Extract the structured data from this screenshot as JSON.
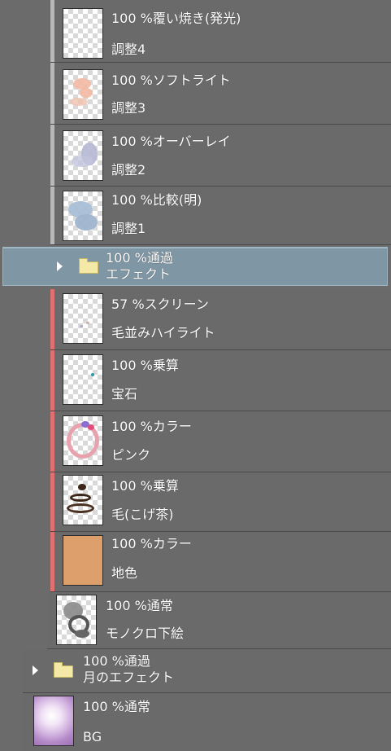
{
  "colors": {
    "panel_bg": "#6a6a6a",
    "selected_bg": "#7f96a4",
    "clip_bar_gray": "#b8b8b8",
    "clip_bar_red": "#e07070",
    "folder": "#f5e9a8",
    "base_color_fill": "#dd9f6c"
  },
  "layers": [
    {
      "opacity": "100 %",
      "blend": "覆い焼き(発光)",
      "name": "調整4",
      "bar": "gray",
      "thumbnail": "transparent-checker"
    },
    {
      "opacity": "100 %",
      "blend": "ソフトライト",
      "name": "調整3",
      "bar": "gray",
      "thumbnail": "peach-strokes"
    },
    {
      "opacity": "100 %",
      "blend": "オーバーレイ",
      "name": "調整2",
      "bar": "gray",
      "thumbnail": "lavender-strokes"
    },
    {
      "opacity": "100 %",
      "blend": "比較(明)",
      "name": "調整1",
      "bar": "gray",
      "thumbnail": "blue-strokes"
    },
    {
      "opacity": "100 %",
      "blend": "通過",
      "name": "エフェクト",
      "type": "folder",
      "selected": true,
      "icon": "folder-icon"
    },
    {
      "opacity": "57 %",
      "blend": "スクリーン",
      "name": "毛並みハイライト",
      "bar": "red",
      "thumbnail": "faint-dots"
    },
    {
      "opacity": "100 %",
      "blend": "乗算",
      "name": "宝石",
      "bar": "red",
      "thumbnail": "teal-dot"
    },
    {
      "opacity": "100 %",
      "blend": "カラー",
      "name": "ピンク",
      "bar": "red",
      "thumbnail": "pink-ring"
    },
    {
      "opacity": "100 %",
      "blend": "乗算",
      "name": "毛(こげ茶)",
      "bar": "red",
      "thumbnail": "dark-brown-strokes"
    },
    {
      "opacity": "100 %",
      "blend": "カラー",
      "name": "地色",
      "bar": "red",
      "thumbnail": "solid-orange"
    },
    {
      "opacity": "100 %",
      "blend": "通常",
      "name": "モノクロ下絵",
      "thumbnail": "gray-sketch"
    },
    {
      "opacity": "100 %",
      "blend": "通過",
      "name": "月のエフェクト",
      "type": "folder",
      "icon": "folder-icon"
    },
    {
      "opacity": "100 %",
      "blend": "通常",
      "name": "BG",
      "thumbnail": "purple-glow"
    }
  ]
}
